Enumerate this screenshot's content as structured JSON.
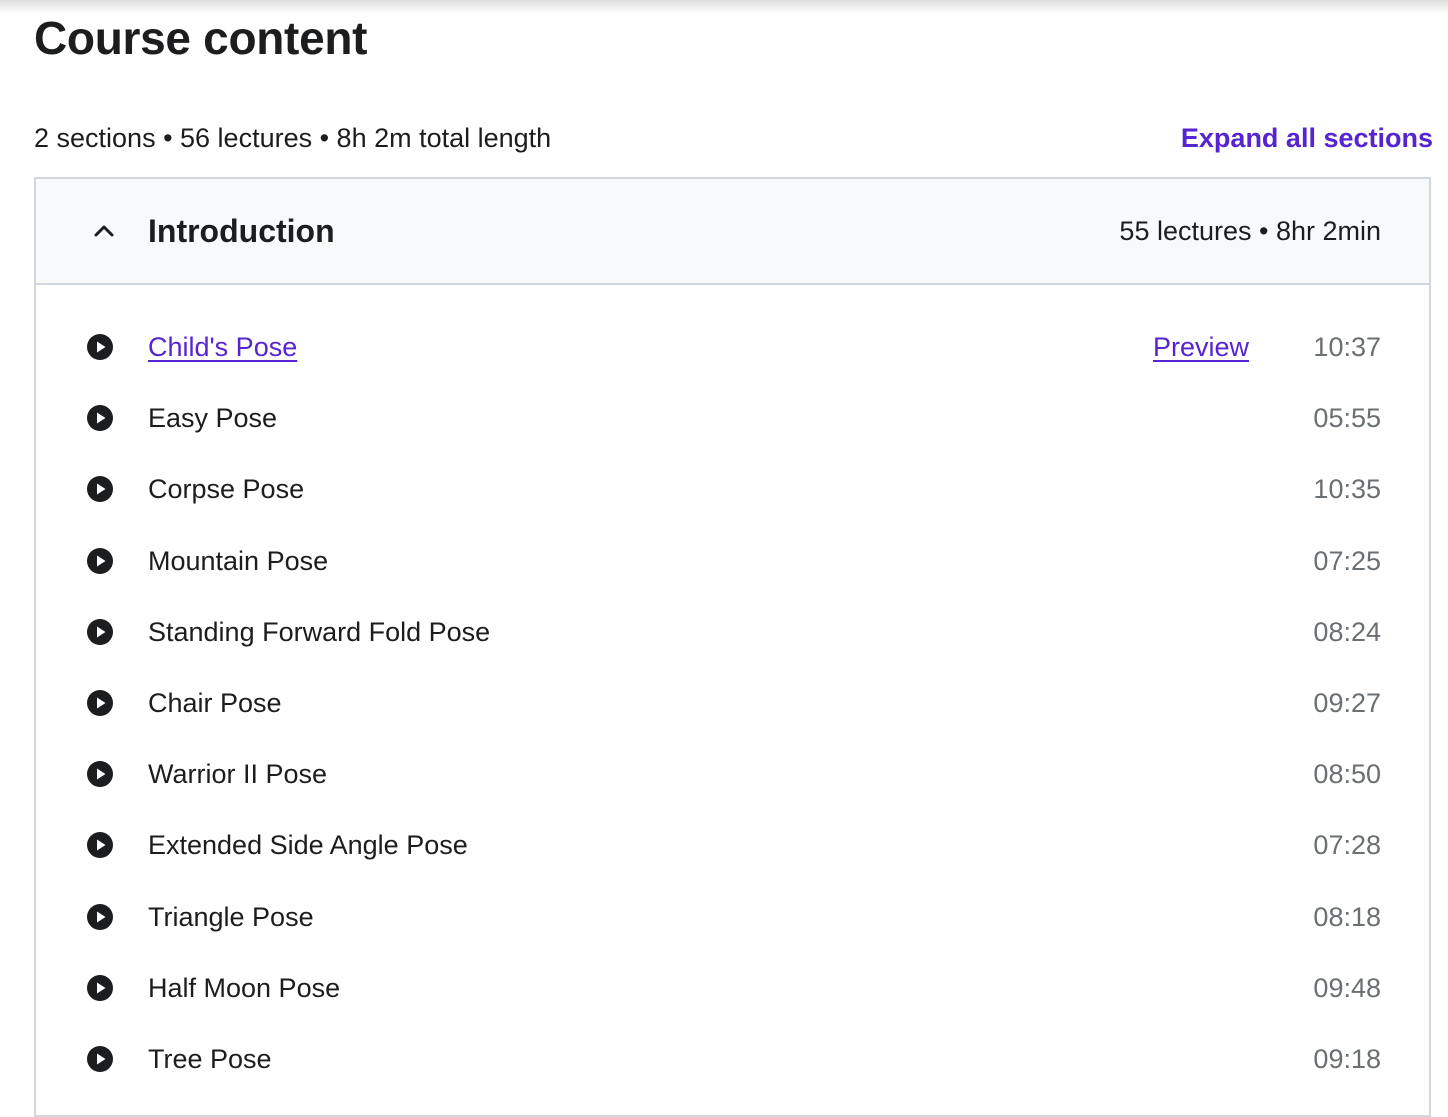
{
  "page": {
    "title": "Course content",
    "summary": "2 sections • 56 lectures • 8h 2m total length",
    "expand_all_label": "Expand all sections"
  },
  "section": {
    "title": "Introduction",
    "meta": "55 lectures • 8hr 2min",
    "expanded": true,
    "icon": "chevron-up-icon"
  },
  "lectures": [
    {
      "title": "Child's Pose",
      "duration": "10:37",
      "preview": "Preview"
    },
    {
      "title": "Easy Pose",
      "duration": "05:55"
    },
    {
      "title": "Corpse Pose",
      "duration": "10:35"
    },
    {
      "title": "Mountain Pose",
      "duration": "07:25"
    },
    {
      "title": "Standing Forward Fold Pose",
      "duration": "08:24"
    },
    {
      "title": "Chair Pose",
      "duration": "09:27"
    },
    {
      "title": "Warrior II Pose",
      "duration": "08:50"
    },
    {
      "title": "Extended Side Angle Pose",
      "duration": "07:28"
    },
    {
      "title": "Triangle Pose",
      "duration": "08:18"
    },
    {
      "title": "Half Moon Pose",
      "duration": "09:48"
    },
    {
      "title": "Tree Pose",
      "duration": "09:18"
    }
  ],
  "colors": {
    "text": "#1c1d1f",
    "accent": "#5624d0",
    "muted": "#6a6f73",
    "border": "#d1d7dc",
    "header_bg": "#f7f9fa"
  },
  "icons": {
    "lecture": "play-circle-icon",
    "section_toggle": "chevron-up-icon"
  }
}
